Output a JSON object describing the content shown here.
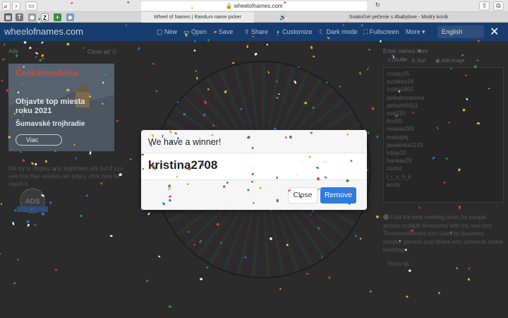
{
  "browser": {
    "url": "wheelofnames.com",
    "tabs": [
      {
        "title": "Wheel of Names | Random name picker"
      },
      {
        "title": "Sviatočné pečenie s #babylove - Modrý koník"
      }
    ]
  },
  "app": {
    "logo": "wheelofnames.com",
    "nav": [
      "New",
      "Open",
      "Save",
      "Share",
      "Customize",
      "Dark mode",
      "Fullscreen",
      "More"
    ],
    "language": "English"
  },
  "ads": {
    "label": "Ads",
    "close_label": "Close ad",
    "brand": "Českárepublika",
    "headline": "Objavte top miesta roku 2021",
    "subline": "Šumavské trojhradie",
    "cta": "Viac",
    "note": "We try to display only legitimate ads but if you see one that violates our policy, click here to report it.",
    "badge_text": "ADS"
  },
  "entries": {
    "label": "Enter names here",
    "shuffle": "Shuffle",
    "sort": "Sort",
    "add_image": "Add image",
    "names": [
      "crosby25",
      "zuzakka18",
      "zuzka3801",
      "jankakocanova",
      "petrah66911",
      "eva233",
      "livvi95",
      "miskaa289",
      "madddej",
      "janulenka1103",
      "lukas20",
      "hankaa29",
      "zuzki1",
      "l_r_x_h_k",
      "acuty"
    ]
  },
  "tip": {
    "text": "Find the best meeting times for people across multiple timezones with my new tool TimezoneWizard.com Used by business people, gamers and others who schedule online meetings.",
    "show_tip": "Show tip"
  },
  "modal": {
    "title": "We have a winner!",
    "winner": "kristina2708",
    "close_label": "Close",
    "remove_label": "Remove"
  },
  "colors": {
    "app_bar": "#173d6e",
    "remove_button": "#2d7be0",
    "overlay": "#2b2b2b"
  }
}
